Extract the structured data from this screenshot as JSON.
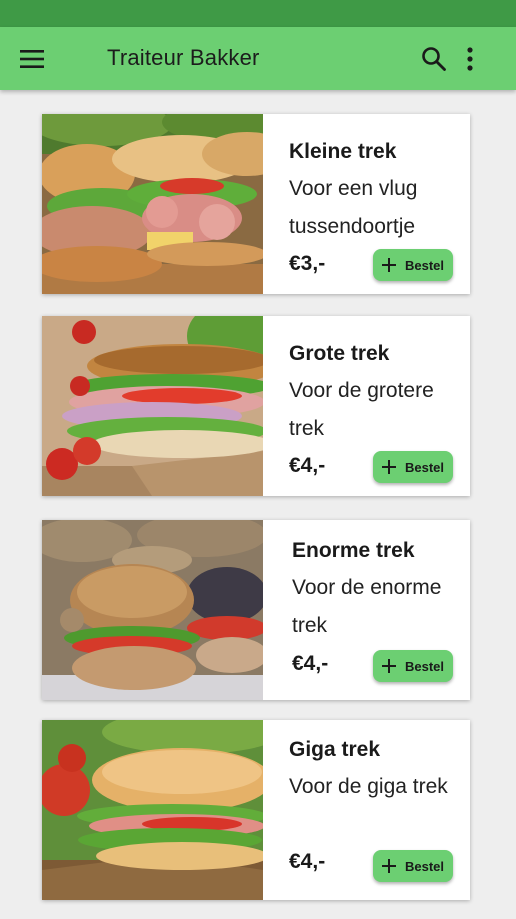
{
  "app_bar": {
    "title": "Traiteur Bakker",
    "icons": [
      "menu-icon",
      "search-icon",
      "more-vert-icon"
    ]
  },
  "colors": {
    "status_bar": "#3f9a46",
    "app_bar": "#6ccf72",
    "button": "#6ccf72",
    "background": "#eeeeee"
  },
  "products": [
    {
      "name": "Kleine trek",
      "description": "Voor een vlug tussendoortje",
      "price": "€3,-",
      "button_label": "Bestel"
    },
    {
      "name": "Grote trek",
      "description": "Voor de grotere trek",
      "price": "€4,-",
      "button_label": "Bestel"
    },
    {
      "name": "Enorme trek",
      "description": "Voor de enorme trek",
      "price": "€4,-",
      "button_label": "Bestel"
    },
    {
      "name": "Giga trek",
      "description": "Voor de giga trek",
      "price": "€4,-",
      "button_label": "Bestel"
    }
  ]
}
